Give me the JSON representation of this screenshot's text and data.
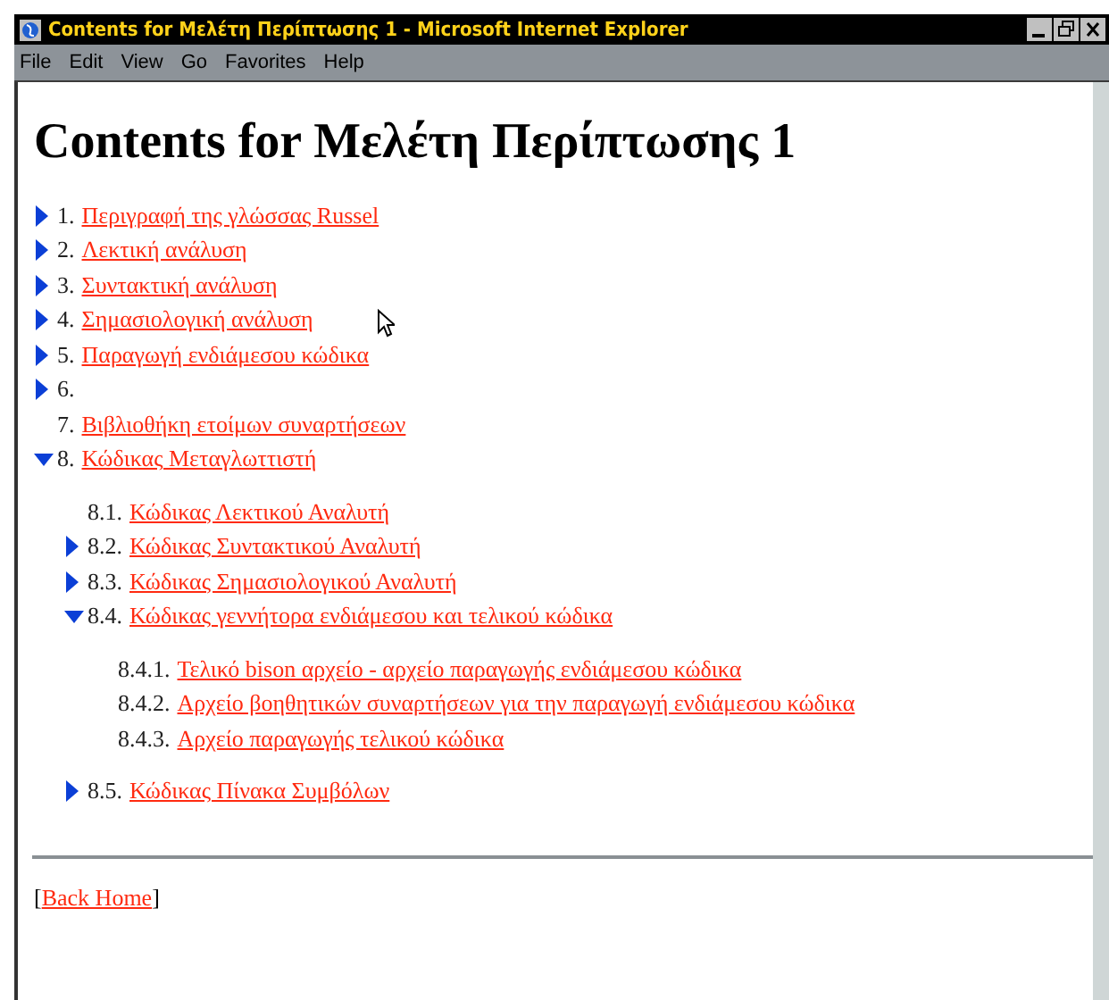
{
  "window": {
    "title": "Contents for Μελέτη Περίπτωσης 1 - Microsoft Internet Explorer"
  },
  "menu": [
    "File",
    "Edit",
    "View",
    "Go",
    "Favorites",
    "Help"
  ],
  "heading": "Contents for Μελέτη Περίπτωσης 1",
  "items": [
    {
      "kind": "collapsed",
      "number": "1.",
      "title": "Περιγραφή της γλώσσας Russel"
    },
    {
      "kind": "collapsed",
      "number": "2.",
      "title": "Λεκτική ανάλυση"
    },
    {
      "kind": "collapsed",
      "number": "3.",
      "title": "Συντακτική ανάλυση"
    },
    {
      "kind": "collapsed",
      "number": "4.",
      "title": "Σημασιολογική ανάλυση"
    },
    {
      "kind": "collapsed",
      "number": "5.",
      "title": "Παραγωγή ενδιάμεσου κώδικα"
    },
    {
      "kind": "collapsed",
      "number": "6."
    },
    {
      "number": "7.",
      "title": "Βιβλιοθήκη ετοίμων συναρτήσεων"
    },
    {
      "kind": "expanded",
      "number": "8.",
      "title": "Κώδικας Μεταγλωττιστή",
      "children": [
        {
          "number": "8.1.",
          "title": "Κώδικας Λεκτικού Αναλυτή"
        },
        {
          "kind": "collapsed",
          "number": "8.2.",
          "title": "Κώδικας Συντακτικού Αναλυτή"
        },
        {
          "kind": "collapsed",
          "number": "8.3.",
          "title": "Κώδικας Σημασιολογικού Αναλυτή"
        },
        {
          "kind": "expanded",
          "number": "8.4.",
          "title": "Κώδικας γεννήτορα ενδιάμεσου και τελικού κώδικα",
          "children": [
            {
              "number": "8.4.1.",
              "title": "Τελικό bison αρχείο - αρχείο παραγωγής ενδιάμεσου κώδικα"
            },
            {
              "number": "8.4.2.",
              "title": "Αρχείο βοηθητικών συναρτήσεων για την παραγωγή ενδιάμεσου κώδικα"
            },
            {
              "number": "8.4.3.",
              "title": "Αρχείο παραγωγής τελικού κώδικα"
            }
          ]
        },
        {
          "kind": "collapsed",
          "number": "8.5.",
          "title": "Κώδικας Πίνακα Συμβόλων"
        }
      ]
    }
  ],
  "back_link": {
    "open": "[",
    "label": "Back Home",
    "close": "]"
  }
}
